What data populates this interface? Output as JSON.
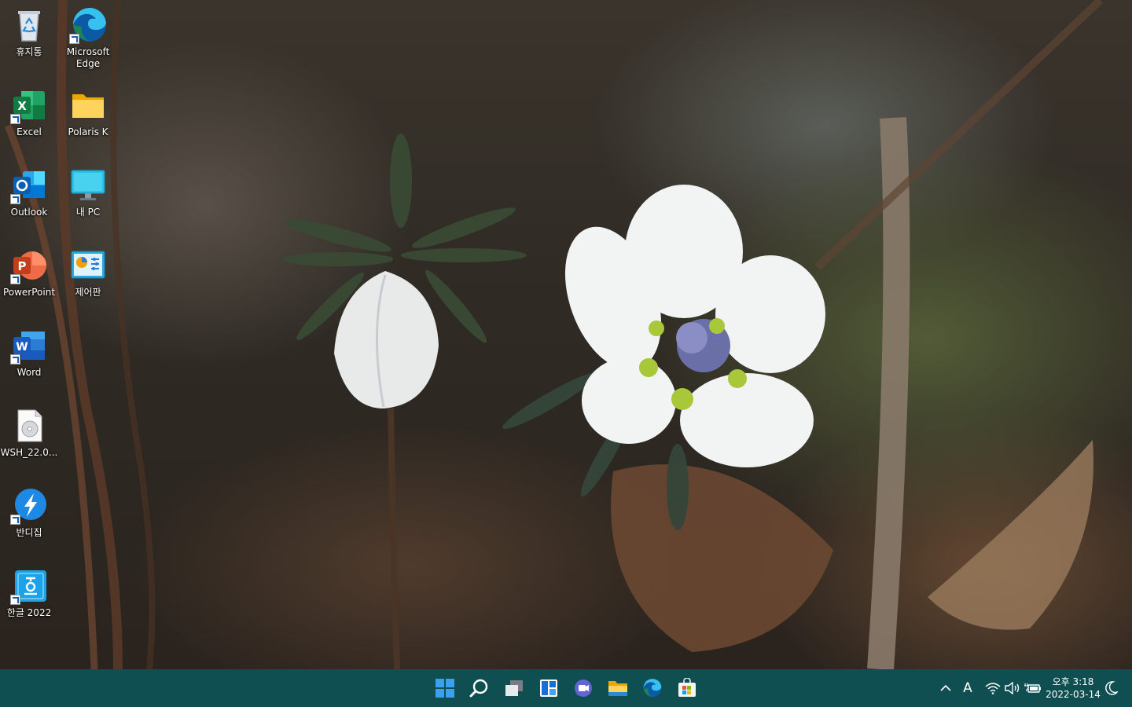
{
  "desktop": {
    "icons": [
      {
        "label": "휴지통",
        "icon": "recycle-bin-icon"
      },
      {
        "label": "Microsoft Edge",
        "icon": "edge-icon"
      },
      {
        "label": "Excel",
        "icon": "excel-icon"
      },
      {
        "label": "Polaris K",
        "icon": "folder-icon"
      },
      {
        "label": "Outlook",
        "icon": "outlook-icon"
      },
      {
        "label": "내 PC",
        "icon": "monitor-icon"
      },
      {
        "label": "PowerPoint",
        "icon": "powerpoint-icon"
      },
      {
        "label": "제어판",
        "icon": "control-panel-icon"
      },
      {
        "label": "Word",
        "icon": "word-icon"
      },
      {
        "label": "WSH_22.0...",
        "icon": "disc-file-icon"
      },
      {
        "label": "반디집",
        "icon": "bandizip-icon"
      },
      {
        "label": "한글 2022",
        "icon": "hangul-icon"
      }
    ]
  },
  "taskbar": {
    "pinned": [
      "start-icon",
      "search-icon",
      "task-view-icon",
      "widgets-icon",
      "teams-chat-icon",
      "file-explorer-icon",
      "edge-icon",
      "store-icon"
    ],
    "tray": {
      "ime": "A",
      "time": "오후 3:18",
      "date": "2022-03-14"
    }
  },
  "colors": {
    "taskbar": "#0f4f52",
    "accent": "#1a5fb4"
  }
}
